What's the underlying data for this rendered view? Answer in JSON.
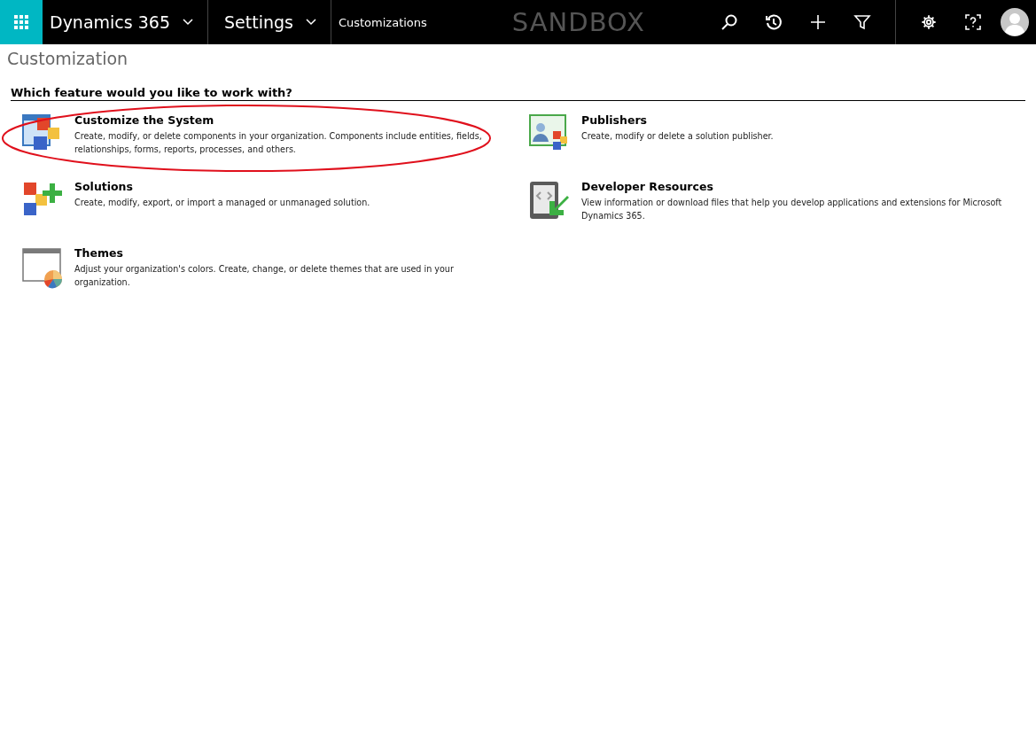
{
  "top_bar": {
    "app_name": "Dynamics 365",
    "area": "Settings",
    "breadcrumb": "Customizations",
    "environment": "SANDBOX"
  },
  "page_title": "Customization",
  "section_heading": "Which feature would you like to work with?",
  "features": [
    {
      "kind": "customize",
      "title": "Customize the System",
      "description": "Create, modify, or delete components in your organization. Components include entities, fields, relationships, forms, reports, processes, and others.",
      "highlighted": true
    },
    {
      "kind": "publishers",
      "title": "Publishers",
      "description": "Create, modify or delete a solution publisher.",
      "highlighted": false
    },
    {
      "kind": "solutions",
      "title": "Solutions",
      "description": "Create, modify, export, or import a managed or unmanaged solution.",
      "highlighted": false
    },
    {
      "kind": "developer",
      "title": "Developer Resources",
      "description": "View information or download files that help you develop applications and extensions for Microsoft Dynamics 365.",
      "highlighted": false
    },
    {
      "kind": "themes",
      "title": "Themes",
      "description": "Adjust your organization's colors. Create, change, or delete themes that are used in your organization.",
      "highlighted": false
    }
  ]
}
